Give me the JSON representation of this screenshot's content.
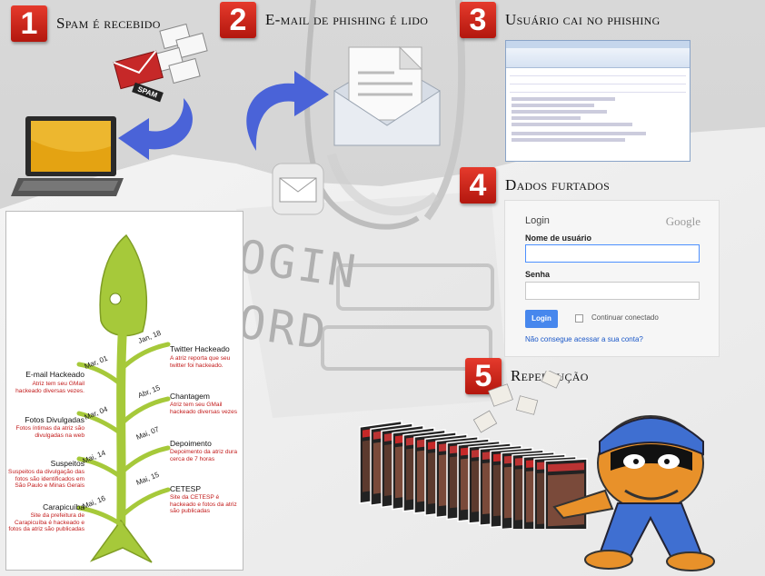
{
  "steps": [
    {
      "num": "1",
      "title": "Spam é recebido"
    },
    {
      "num": "2",
      "title": "E-mail de phishing é lido"
    },
    {
      "num": "3",
      "title": "Usuário cai no phishing"
    },
    {
      "num": "4",
      "title": "Dados furtados"
    },
    {
      "num": "5",
      "title": "Repercução"
    }
  ],
  "spam_tag": "SPAM",
  "background_words": [
    "OGIN",
    "ORD"
  ],
  "login": {
    "title": "Login",
    "brand": "Google",
    "username_label": "Nome de usuário",
    "password_label": "Senha",
    "button": "Login",
    "remember": "Continuar conectado",
    "forgot": "Não consegue acessar a sua conta?"
  },
  "timeline": {
    "right": [
      {
        "date": "Jan, 18",
        "title": "Twitter Hackeado",
        "desc": "A atriz reporta que seu twitter foi hackeado."
      },
      {
        "date": "Abr, 15",
        "title": "Chantagem",
        "desc": "Atriz tem seu GMail hackeado diversas vezes"
      },
      {
        "date": "Mai, 07",
        "title": "Depoimento",
        "desc": "Depoimento da atriz dura cerca de 7 horas"
      },
      {
        "date": "Mai, 15",
        "title": "CETESP",
        "desc": "Site da CETESP é hackeado e fotos da atriz são publicadas"
      }
    ],
    "left": [
      {
        "date": "Mar, 01",
        "title": "E-mail Hackeado",
        "desc": "Atriz tem seu GMail hackeado diversas vezes."
      },
      {
        "date": "Mar, 04",
        "title": "Fotos Divulgadas",
        "desc": "Fotos íntimas da atriz são divulgadas na web"
      },
      {
        "date": "Mai, 14",
        "title": "Suspeitos",
        "desc": "Suspeitos da divulgação das fotos são identificados em São Paulo e Minas Gerais"
      },
      {
        "date": "Mai, 16",
        "title": "Carapicuíba",
        "desc": "Site da prefeitura de Carapicuíba é hackeado e fotos da atriz são publicadas"
      }
    ]
  },
  "colors": {
    "badge": "#d42a1e",
    "fish": "#a6c93a",
    "arrow": "#4a63d8",
    "desc_red": "#c21a1a"
  }
}
